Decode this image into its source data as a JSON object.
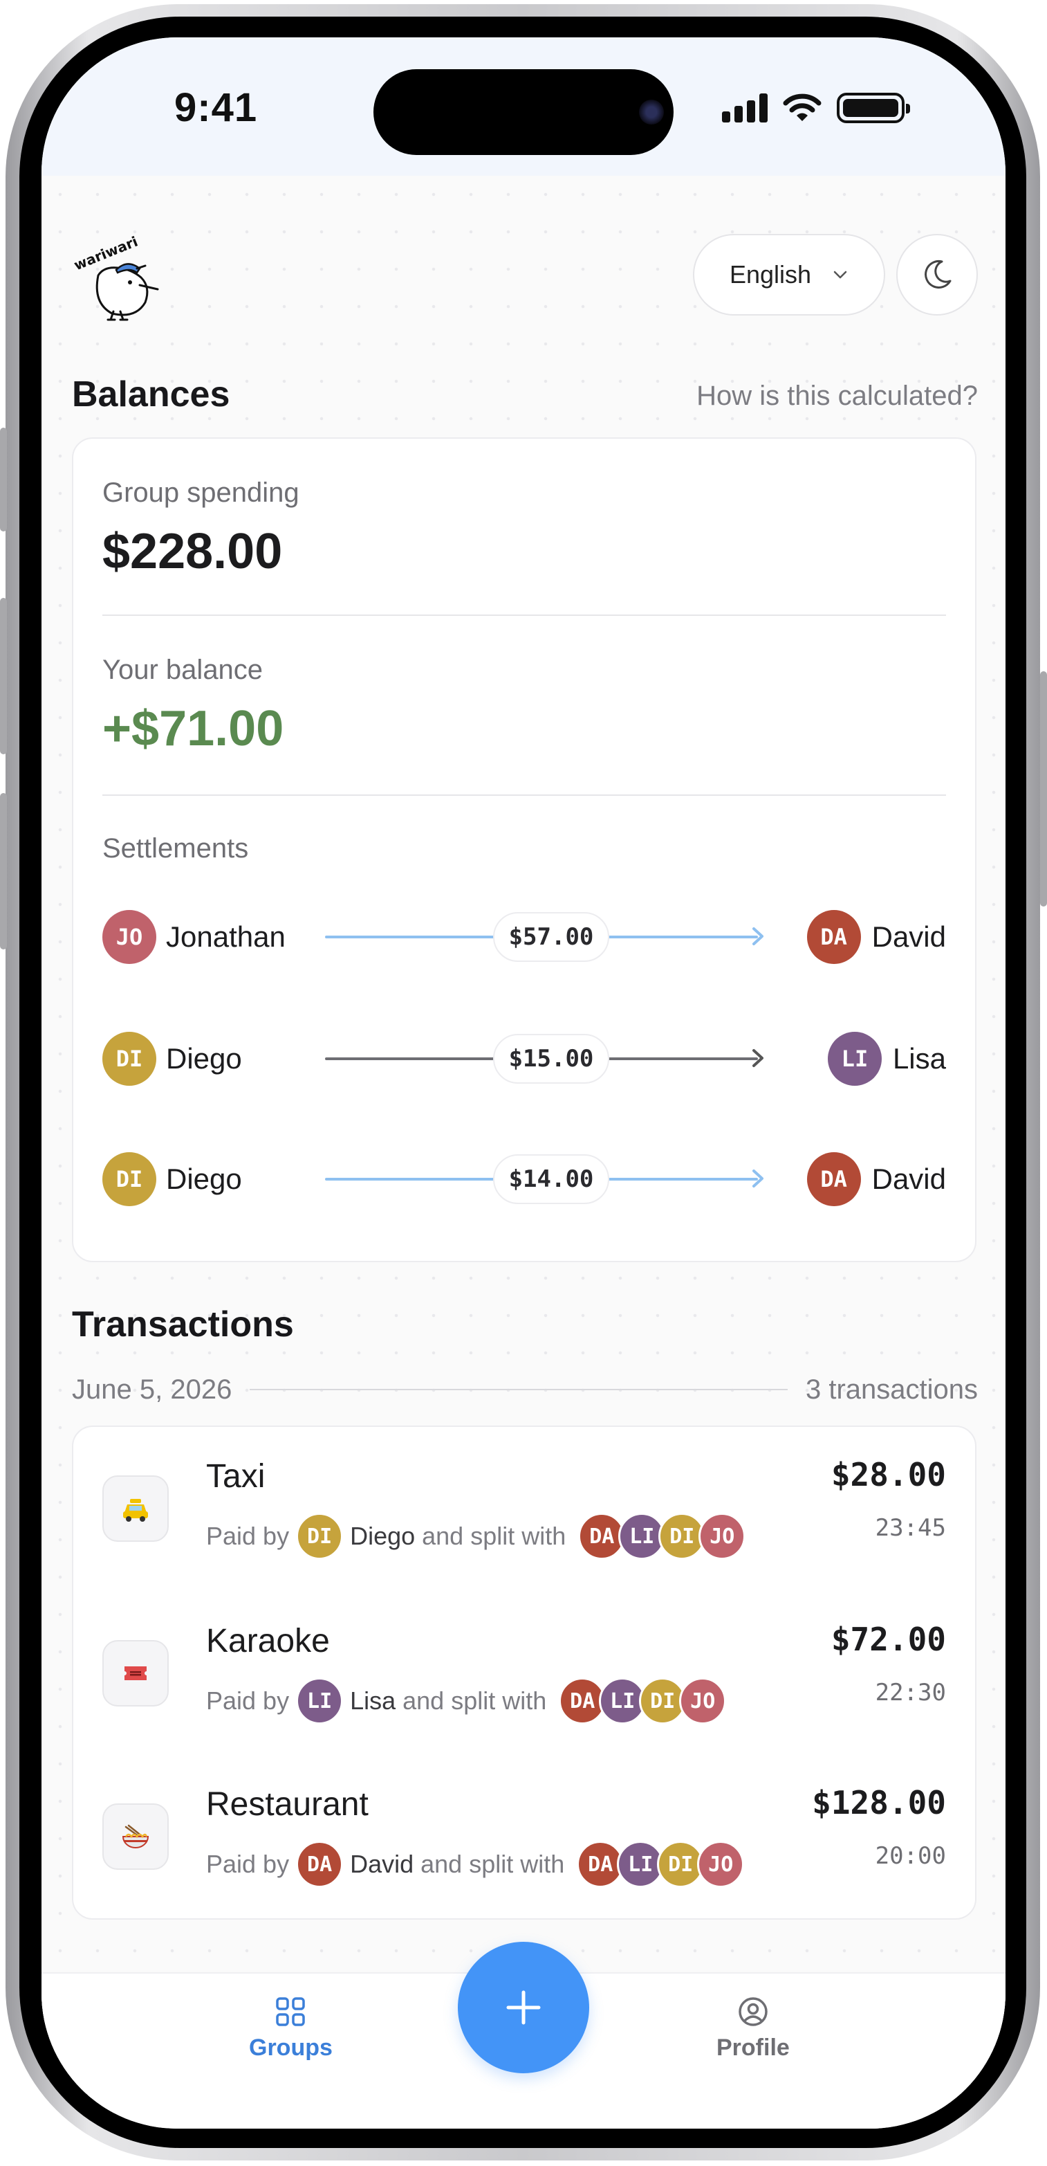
{
  "status_bar": {
    "time": "9:41"
  },
  "header": {
    "logo_text": "wariwari",
    "language": "English"
  },
  "balances": {
    "title": "Balances",
    "help_link": "How is this calculated?",
    "group_spending_label": "Group spending",
    "group_spending": "$228.00",
    "your_balance_label": "Your balance",
    "your_balance": "+$71.00",
    "settlements_label": "Settlements",
    "settlements": [
      {
        "from_initials": "JO",
        "from": "Jonathan",
        "amount": "$57.00",
        "to_initials": "DA",
        "to": "David",
        "highlight": true
      },
      {
        "from_initials": "DI",
        "from": "Diego",
        "amount": "$15.00",
        "to_initials": "LI",
        "to": "Lisa",
        "highlight": false
      },
      {
        "from_initials": "DI",
        "from": "Diego",
        "amount": "$14.00",
        "to_initials": "DA",
        "to": "David",
        "highlight": true
      }
    ]
  },
  "transactions": {
    "title": "Transactions",
    "date": "June 5, 2026",
    "count": "3 transactions",
    "paid_by_label": "Paid by",
    "split_label": "and split with",
    "items": [
      {
        "icon": "taxi-icon",
        "title": "Taxi",
        "payer_initials": "DI",
        "payer": "Diego",
        "split": [
          "DA",
          "LI",
          "DI",
          "JO"
        ],
        "amount": "$28.00",
        "time": "23:45"
      },
      {
        "icon": "ticket-icon",
        "title": "Karaoke",
        "payer_initials": "LI",
        "payer": "Lisa",
        "split": [
          "DA",
          "LI",
          "DI",
          "JO"
        ],
        "amount": "$72.00",
        "time": "22:30"
      },
      {
        "icon": "noodle-bowl-icon",
        "title": "Restaurant",
        "payer_initials": "DA",
        "payer": "David",
        "split": [
          "DA",
          "LI",
          "DI",
          "JO"
        ],
        "amount": "$128.00",
        "time": "20:00"
      }
    ]
  },
  "tabbar": {
    "groups": "Groups",
    "profile": "Profile",
    "add_icon": "plus-icon"
  },
  "colors": {
    "accent": "#4394f7",
    "positive": "#5a8a50",
    "avatar_JO": "#c0626b",
    "avatar_DA": "#b24a36",
    "avatar_DI": "#c6a33c",
    "avatar_LI": "#7d5c8a",
    "line_highlight": "#8ec0f0",
    "line_default": "#6e6e73"
  }
}
